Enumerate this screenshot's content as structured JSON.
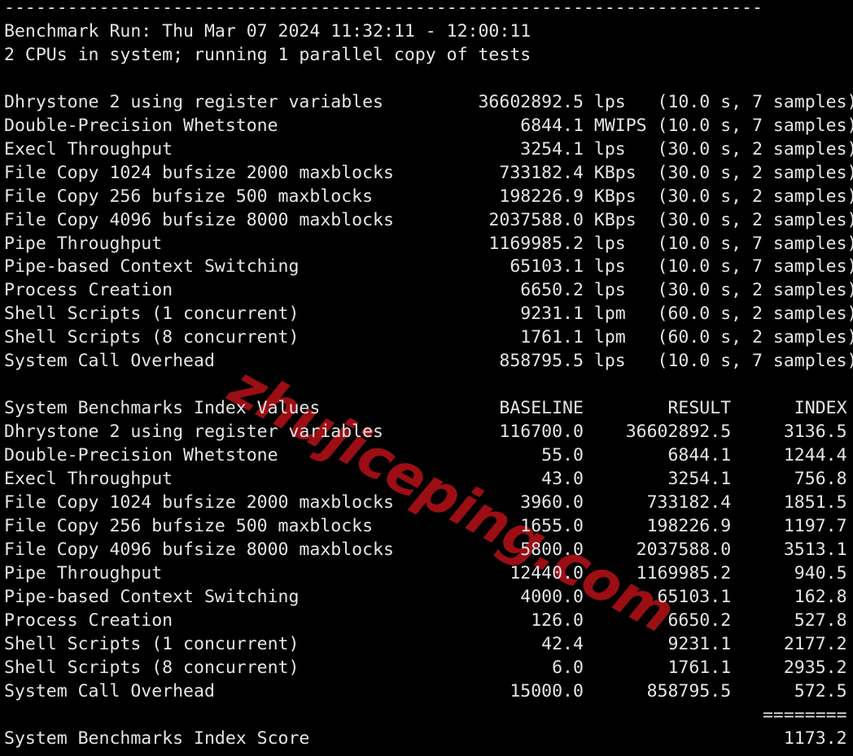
{
  "terminal": {
    "background_color": "#000000",
    "text_color": "#e6e6e6",
    "watermark": {
      "text": "zhujiceping.com",
      "color": "#9b0e14"
    },
    "separator_top": "------------------------------------------------------------------------",
    "header": {
      "benchmark_run_label": "Benchmark Run:",
      "benchmark_run_value": "Thu Mar 07 2024 11:32:11 - 12:00:11",
      "cpu_line": "2 CPUs in system; running 1 parallel copy of tests"
    },
    "results": {
      "rows": [
        {
          "name": "Dhrystone 2 using register variables",
          "value": "36602892.5",
          "unit": "lps",
          "duration": "10.0 s",
          "samples": "7 samples"
        },
        {
          "name": "Double-Precision Whetstone",
          "value": "6844.1",
          "unit": "MWIPS",
          "duration": "10.0 s",
          "samples": "7 samples"
        },
        {
          "name": "Execl Throughput",
          "value": "3254.1",
          "unit": "lps",
          "duration": "30.0 s",
          "samples": "2 samples"
        },
        {
          "name": "File Copy 1024 bufsize 2000 maxblocks",
          "value": "733182.4",
          "unit": "KBps",
          "duration": "30.0 s",
          "samples": "2 samples"
        },
        {
          "name": "File Copy 256 bufsize 500 maxblocks",
          "value": "198226.9",
          "unit": "KBps",
          "duration": "30.0 s",
          "samples": "2 samples"
        },
        {
          "name": "File Copy 4096 bufsize 8000 maxblocks",
          "value": "2037588.0",
          "unit": "KBps",
          "duration": "30.0 s",
          "samples": "2 samples"
        },
        {
          "name": "Pipe Throughput",
          "value": "1169985.2",
          "unit": "lps",
          "duration": "10.0 s",
          "samples": "7 samples"
        },
        {
          "name": "Pipe-based Context Switching",
          "value": "65103.1",
          "unit": "lps",
          "duration": "10.0 s",
          "samples": "7 samples"
        },
        {
          "name": "Process Creation",
          "value": "6650.2",
          "unit": "lps",
          "duration": "30.0 s",
          "samples": "2 samples"
        },
        {
          "name": "Shell Scripts (1 concurrent)",
          "value": "9231.1",
          "unit": "lpm",
          "duration": "60.0 s",
          "samples": "2 samples"
        },
        {
          "name": "Shell Scripts (8 concurrent)",
          "value": "1761.1",
          "unit": "lpm",
          "duration": "60.0 s",
          "samples": "2 samples"
        },
        {
          "name": "System Call Overhead",
          "value": "858795.5",
          "unit": "lps",
          "duration": "10.0 s",
          "samples": "7 samples"
        }
      ]
    },
    "index_table": {
      "title": "System Benchmarks Index Values",
      "columns": [
        "BASELINE",
        "RESULT",
        "INDEX"
      ],
      "rows": [
        {
          "name": "Dhrystone 2 using register variables",
          "baseline": "116700.0",
          "result": "36602892.5",
          "index": "3136.5"
        },
        {
          "name": "Double-Precision Whetstone",
          "baseline": "55.0",
          "result": "6844.1",
          "index": "1244.4"
        },
        {
          "name": "Execl Throughput",
          "baseline": "43.0",
          "result": "3254.1",
          "index": "756.8"
        },
        {
          "name": "File Copy 1024 bufsize 2000 maxblocks",
          "baseline": "3960.0",
          "result": "733182.4",
          "index": "1851.5"
        },
        {
          "name": "File Copy 256 bufsize 500 maxblocks",
          "baseline": "1655.0",
          "result": "198226.9",
          "index": "1197.7"
        },
        {
          "name": "File Copy 4096 bufsize 8000 maxblocks",
          "baseline": "5800.0",
          "result": "2037588.0",
          "index": "3513.1"
        },
        {
          "name": "Pipe Throughput",
          "baseline": "12440.0",
          "result": "1169985.2",
          "index": "940.5"
        },
        {
          "name": "Pipe-based Context Switching",
          "baseline": "4000.0",
          "result": "65103.1",
          "index": "162.8"
        },
        {
          "name": "Process Creation",
          "baseline": "126.0",
          "result": "6650.2",
          "index": "527.8"
        },
        {
          "name": "Shell Scripts (1 concurrent)",
          "baseline": "42.4",
          "result": "9231.1",
          "index": "2177.2"
        },
        {
          "name": "Shell Scripts (8 concurrent)",
          "baseline": "6.0",
          "result": "1761.1",
          "index": "2935.2"
        },
        {
          "name": "System Call Overhead",
          "baseline": "15000.0",
          "result": "858795.5",
          "index": "572.5"
        }
      ],
      "score_separator": "========",
      "score_label": "System Benchmarks Index Score",
      "score_value": "1173.2"
    }
  }
}
